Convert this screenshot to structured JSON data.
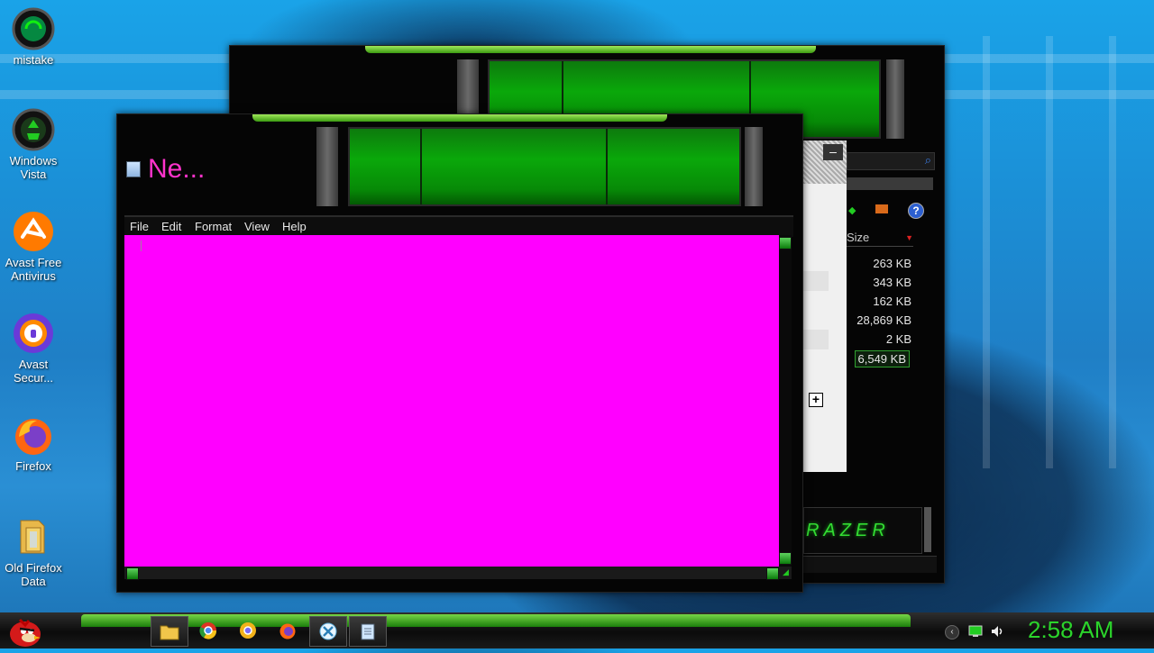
{
  "desktop": {
    "icons": [
      {
        "label": "mistake",
        "icon": "razer-orb-icon"
      },
      {
        "label": "Windows Vista",
        "icon": "recycle-bin-icon"
      },
      {
        "label": "Avast Free Antivirus",
        "icon": "avast-icon"
      },
      {
        "label": "Avast Secur...",
        "icon": "avast-secure-browser-icon"
      },
      {
        "label": "Firefox",
        "icon": "firefox-icon"
      },
      {
        "label": "Old Firefox Data",
        "icon": "folder-icon"
      }
    ]
  },
  "notepad": {
    "title": "Ne...",
    "menu": [
      "File",
      "Edit",
      "Format",
      "View",
      "Help"
    ],
    "content": "",
    "colors": {
      "edit_background": "#ff00ff",
      "title_text": "#ff33cc"
    }
  },
  "explorer": {
    "column_header": "Size",
    "sizes": [
      "263 KB",
      "343 KB",
      "162 KB",
      "28,869 KB",
      "2 KB",
      "6,549 KB"
    ],
    "selected_index": 5,
    "branding": "RAZER"
  },
  "taskbar": {
    "start_icon": "angry-birds-icon",
    "items": [
      {
        "icon": "folder-icon",
        "active": true
      },
      {
        "icon": "chrome-icon",
        "active": false
      },
      {
        "icon": "chrome-canary-icon",
        "active": false
      },
      {
        "icon": "firefox-icon",
        "active": false
      },
      {
        "icon": "xbox-icon",
        "active": true
      },
      {
        "icon": "notepad-icon",
        "active": true
      }
    ],
    "tray_icons": [
      "chevron-left-icon",
      "network-icon",
      "volume-icon"
    ],
    "clock": "2:58 AM",
    "accent": "#2bd42b"
  }
}
